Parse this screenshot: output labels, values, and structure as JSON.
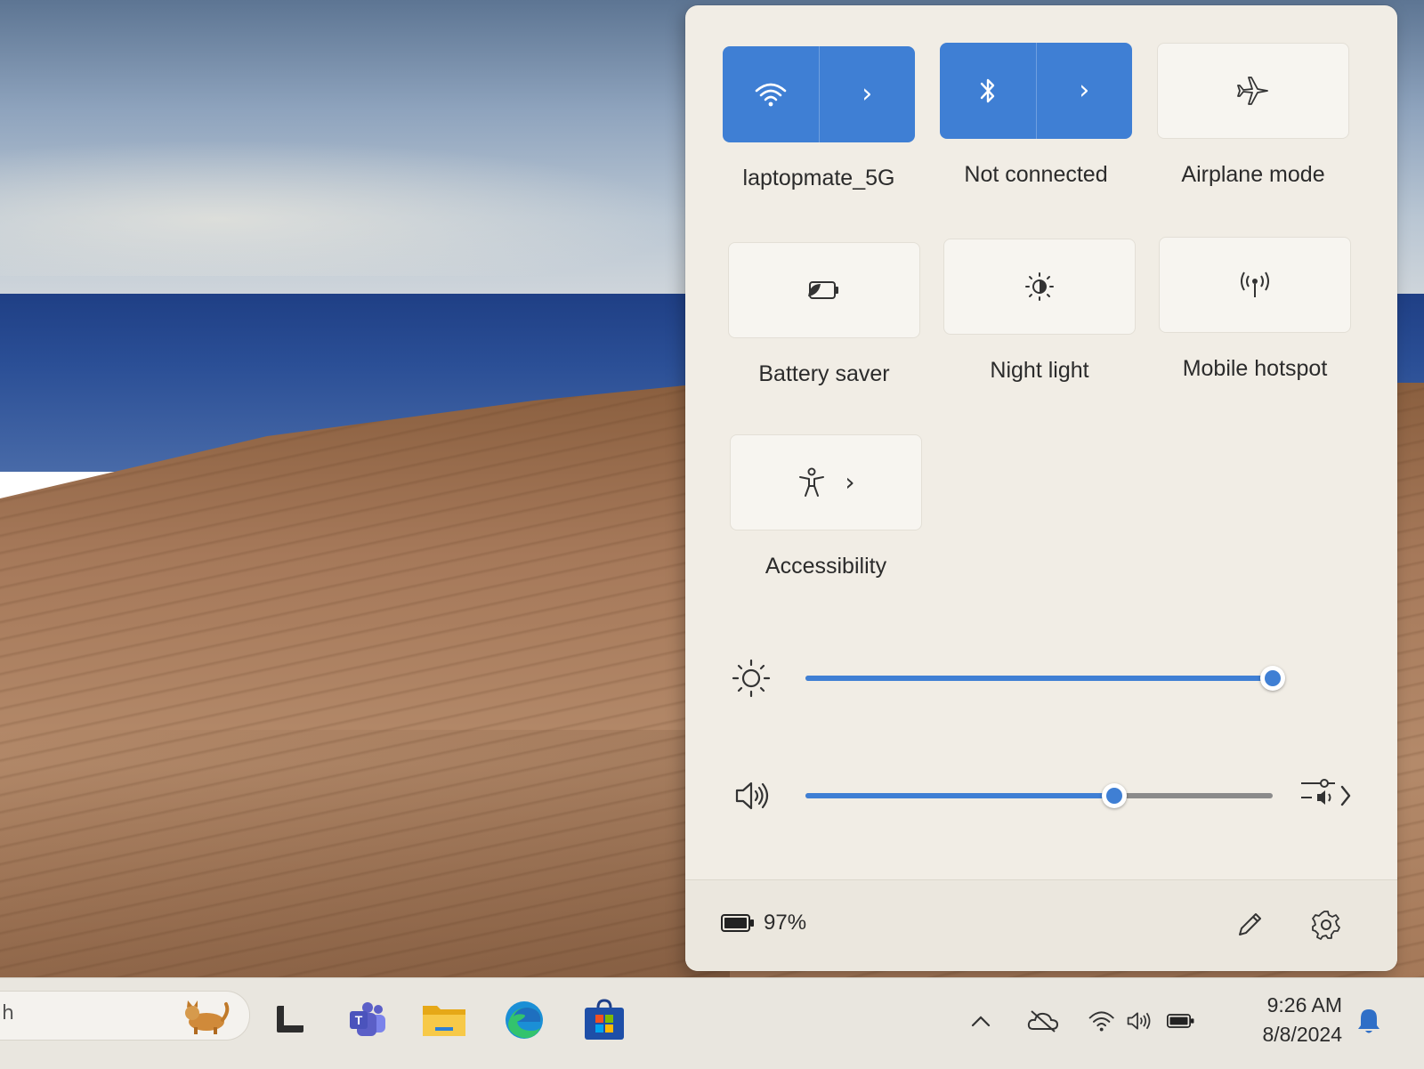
{
  "quick_settings": {
    "tiles": [
      {
        "label": "laptopmate_5G",
        "icon": "wifi-icon",
        "active": true
      },
      {
        "label": "Not connected",
        "icon": "bluetooth-icon",
        "active": true
      },
      {
        "label": "Airplane mode",
        "icon": "airplane-icon",
        "active": false
      },
      {
        "label": "Battery saver",
        "icon": "battery-saver-icon",
        "active": false
      },
      {
        "label": "Night light",
        "icon": "night-light-icon",
        "active": false
      },
      {
        "label": "Mobile hotspot",
        "icon": "hotspot-icon",
        "active": false
      },
      {
        "label": "Accessibility",
        "icon": "accessibility-icon",
        "active": false
      }
    ],
    "brightness": {
      "icon": "brightness-icon",
      "level": 1.0
    },
    "volume": {
      "icon": "speaker-icon",
      "level": 0.66
    },
    "footer": {
      "battery_percent": "97%",
      "edit_icon": "pencil-icon",
      "settings_icon": "gear-icon"
    }
  },
  "taskbar": {
    "search_text": "h",
    "apps": [
      "task-view-icon",
      "teams-icon",
      "file-explorer-icon",
      "edge-icon",
      "store-icon"
    ],
    "tray": [
      "chevron-up-icon",
      "onedrive-icon",
      "wifi-icon",
      "speaker-icon",
      "battery-icon"
    ],
    "time": "9:26 AM",
    "date": "8/8/2024",
    "notification_icon": "bell-icon"
  },
  "colors": {
    "accent": "#3f7fd4",
    "flyout_bg": "#f1ede5",
    "taskbar_bg": "#e9e6df"
  }
}
